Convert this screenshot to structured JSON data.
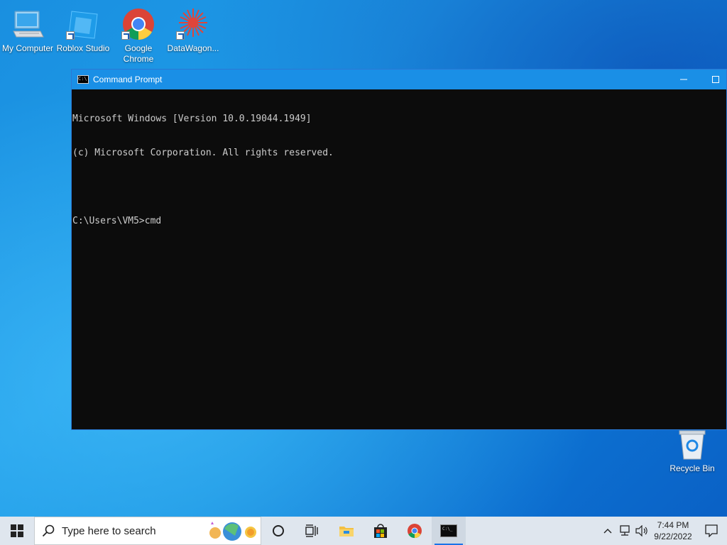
{
  "desktop": {
    "icons": [
      {
        "label": "My Computer"
      },
      {
        "label": "Roblox Studio"
      },
      {
        "label": "Google Chrome"
      },
      {
        "label": "DataWagon..."
      }
    ],
    "recycle_bin": {
      "label": "Recycle Bin"
    }
  },
  "cmd_window": {
    "title": "Command Prompt",
    "lines": [
      "Microsoft Windows [Version 10.0.19044.1949]",
      "(c) Microsoft Corporation. All rights reserved.",
      "",
      "C:\\Users\\VM5>cmd"
    ]
  },
  "taskbar": {
    "search_placeholder": "Type here to search",
    "pinned": [
      "start-icon",
      "search-icon",
      "cortana-icon",
      "task-view-icon",
      "file-explorer-icon",
      "store-icon",
      "chrome-icon",
      "command-prompt-icon"
    ],
    "clock": {
      "time": "7:44 PM",
      "date": "9/22/2022"
    }
  },
  "colors": {
    "titlebar": "#1a8fe6",
    "console_bg": "#0c0c0c",
    "console_text": "#cccccc",
    "taskbar_bg": "#dfe6ee"
  }
}
